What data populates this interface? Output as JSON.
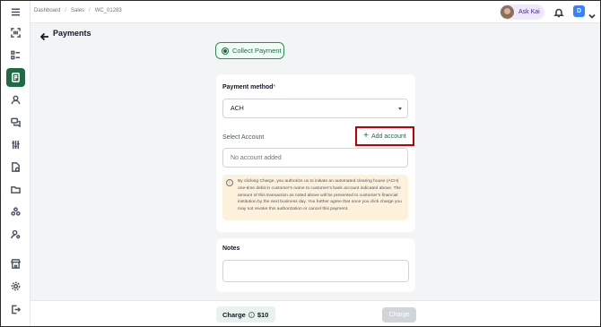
{
  "breadcrumbs": [
    "Dashboard",
    "Sales",
    "WC_01283"
  ],
  "header": {
    "title": "Payments",
    "ask_kai": "Ask Kai",
    "user_initial": "D"
  },
  "payment_type": {
    "label": "Collect Payment",
    "selected": true
  },
  "payment_method": {
    "label": "Payment method",
    "required_mark": "*",
    "value": "ACH"
  },
  "account": {
    "label": "Select Account",
    "add_label": "Add account",
    "placeholder": "No account added"
  },
  "notice": "By clicking Charge, you authorize us to initiate an automated clearing house (ACH) one-time debit in customer's name to customer's bank account indicated above. The amount of this transaction as noted above will be presented to customer's financial institution by the next business day. You further agree that once you click charge you may not revoke this authorization or cancel this payment.",
  "notes": {
    "label": "Notes",
    "value": ""
  },
  "footer": {
    "charge_label": "Charge",
    "amount": "$10",
    "charge_button": "Charge"
  },
  "colors": {
    "brand_green": "#1f6b45",
    "highlight_red": "#c00000",
    "notice_bg": "#fdf1dc"
  },
  "sidebar_icons": [
    "menu-icon",
    "scan-icon",
    "list-icon",
    "invoice-icon",
    "user-icon",
    "chat-icon",
    "sliders-icon",
    "document-icon",
    "folder-icon",
    "group-icon",
    "user-settings-icon",
    "store-icon",
    "gear-icon",
    "logout-icon"
  ]
}
